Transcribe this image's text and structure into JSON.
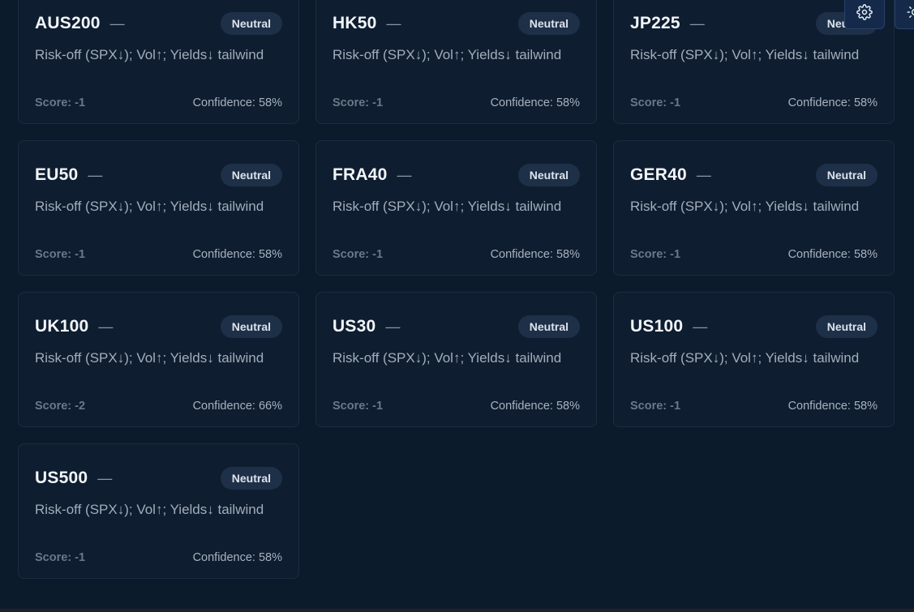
{
  "cards": [
    {
      "symbol": "AUS200",
      "dash": "—",
      "bias": "Neutral",
      "summary": "Risk-off (SPX↓); Vol↑; Yields↓ tailwind",
      "score": "Score: -1",
      "confidence": "Confidence: 58%"
    },
    {
      "symbol": "HK50",
      "dash": "—",
      "bias": "Neutral",
      "summary": "Risk-off (SPX↓); Vol↑; Yields↓ tailwind",
      "score": "Score: -1",
      "confidence": "Confidence: 58%"
    },
    {
      "symbol": "JP225",
      "dash": "—",
      "bias": "Neutral",
      "summary": "Risk-off (SPX↓); Vol↑; Yields↓ tailwind",
      "score": "Score: -1",
      "confidence": "Confidence: 58%"
    },
    {
      "symbol": "EU50",
      "dash": "—",
      "bias": "Neutral",
      "summary": "Risk-off (SPX↓); Vol↑; Yields↓ tailwind",
      "score": "Score: -1",
      "confidence": "Confidence: 58%"
    },
    {
      "symbol": "FRA40",
      "dash": "—",
      "bias": "Neutral",
      "summary": "Risk-off (SPX↓); Vol↑; Yields↓ tailwind",
      "score": "Score: -1",
      "confidence": "Confidence: 58%"
    },
    {
      "symbol": "GER40",
      "dash": "—",
      "bias": "Neutral",
      "summary": "Risk-off (SPX↓); Vol↑; Yields↓ tailwind",
      "score": "Score: -1",
      "confidence": "Confidence: 58%"
    },
    {
      "symbol": "UK100",
      "dash": "—",
      "bias": "Neutral",
      "summary": "Risk-off (SPX↓); Vol↑; Yields↓ tailwind",
      "score": "Score: -2",
      "confidence": "Confidence: 66%"
    },
    {
      "symbol": "US30",
      "dash": "—",
      "bias": "Neutral",
      "summary": "Risk-off (SPX↓); Vol↑; Yields↓ tailwind",
      "score": "Score: -1",
      "confidence": "Confidence: 58%"
    },
    {
      "symbol": "US100",
      "dash": "—",
      "bias": "Neutral",
      "summary": "Risk-off (SPX↓); Vol↑; Yields↓ tailwind",
      "score": "Score: -1",
      "confidence": "Confidence: 58%"
    },
    {
      "symbol": "US500",
      "dash": "—",
      "bias": "Neutral",
      "summary": "Risk-off (SPX↓); Vol↑; Yields↓ tailwind",
      "score": "Score: -1",
      "confidence": "Confidence: 58%"
    }
  ],
  "toolbar": {
    "settings_icon": "gear-icon",
    "theme_icon": "sun-icon"
  },
  "colors": {
    "background": "#0c1b2c",
    "card": "#0e1d30",
    "badge": "#1e3048",
    "corner_button": "#15294a"
  }
}
